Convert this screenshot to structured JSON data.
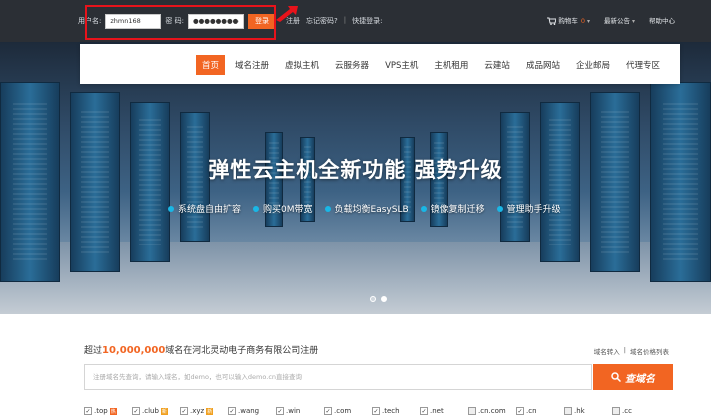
{
  "topbar": {
    "username_label": "用户名:",
    "username_value": "zhmn168",
    "password_label": "密  码:",
    "password_value": "●●●●●●●●●",
    "login_button": "登录",
    "register_link": "注册",
    "forgot_link": "忘记密码?",
    "separator": "|",
    "quick_login": "快捷登录:",
    "cart_label": "购物车",
    "cart_count": "0",
    "notice_label": "最新公告",
    "help_label": "帮助中心"
  },
  "nav": {
    "items": [
      "首页",
      "域名注册",
      "虚拟主机",
      "云服务器",
      "VPS主机",
      "主机租用",
      "云建站",
      "成品网站",
      "企业邮局",
      "代理专区"
    ]
  },
  "hero": {
    "title": "弹性云主机全新功能  强势升级",
    "features": [
      "系统盘自由扩容",
      "购买0M带宽",
      "负载均衡EasySLB",
      "镜像复制迁移",
      "管理助手升级"
    ]
  },
  "domain": {
    "title_prefix": "超过",
    "title_number": "10,000,000",
    "title_suffix": "域名在河北灵动电子商务有限公司注册",
    "link_transfer": "域名转入",
    "link_sep": "|",
    "link_price": "域名价格列表",
    "search_placeholder": "注册域名先查询，请输入域名，如demo，也可以输入demo.cn直接查询",
    "search_button": "查域名",
    "tlds": [
      {
        "name": ".top",
        "tag": "热",
        "checked": true
      },
      {
        "name": ".club",
        "tag": "新",
        "checked": true
      },
      {
        "name": ".xyz",
        "tag": "新",
        "checked": true
      },
      {
        "name": ".wang",
        "tag": "",
        "checked": true
      },
      {
        "name": ".win",
        "tag": "",
        "checked": true
      },
      {
        "name": ".com",
        "tag": "",
        "checked": true
      },
      {
        "name": ".tech",
        "tag": "",
        "checked": true
      },
      {
        "name": ".net",
        "tag": "",
        "checked": true
      },
      {
        "name": ".cn.com",
        "tag": "",
        "checked": false
      },
      {
        "name": ".cn",
        "tag": "",
        "checked": true
      },
      {
        "name": ".hk",
        "tag": "",
        "checked": false
      },
      {
        "name": ".cc",
        "tag": "",
        "checked": false
      }
    ]
  },
  "colors": {
    "accent": "#f26522",
    "topbar": "#2b2f35",
    "highlight": "#e8131b",
    "feature_dot": "#19b7e6"
  }
}
